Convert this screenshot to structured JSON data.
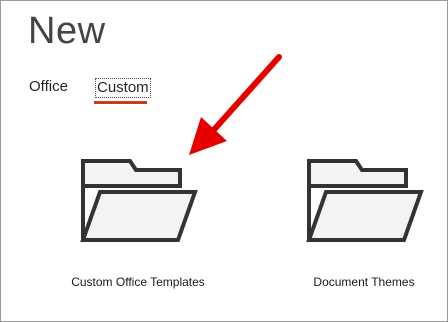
{
  "page": {
    "title": "New"
  },
  "tabs": [
    {
      "label": "Office",
      "selected": false
    },
    {
      "label": "Custom",
      "selected": true
    }
  ],
  "folders": [
    {
      "label": "Custom Office Templates",
      "icon": "folder-open-icon"
    },
    {
      "label": "Document Themes",
      "icon": "folder-open-icon"
    }
  ],
  "annotation": {
    "arrow_color": "#e60000",
    "points_to": "Custom Office Templates"
  },
  "colors": {
    "tab_underline": "#c43e1c",
    "folder_stroke": "#333333",
    "folder_fill": "#f3f3f3"
  }
}
